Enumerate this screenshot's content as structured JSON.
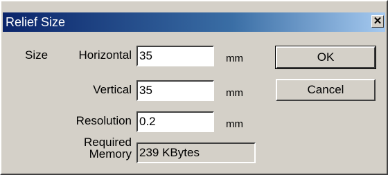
{
  "window": {
    "title": "Relief Size",
    "close_glyph": "✕"
  },
  "form": {
    "size_label": "Size",
    "horizontal": {
      "label": "Horizontal",
      "value": "35",
      "unit": "mm"
    },
    "vertical": {
      "label": "Vertical",
      "value": "35",
      "unit": "mm"
    },
    "resolution": {
      "label": "Resolution",
      "value": "0.2",
      "unit": "mm"
    },
    "memory": {
      "label_line1": "Required",
      "label_line2": "Memory",
      "value": "239 KBytes"
    }
  },
  "buttons": {
    "ok": "OK",
    "cancel": "Cancel"
  }
}
